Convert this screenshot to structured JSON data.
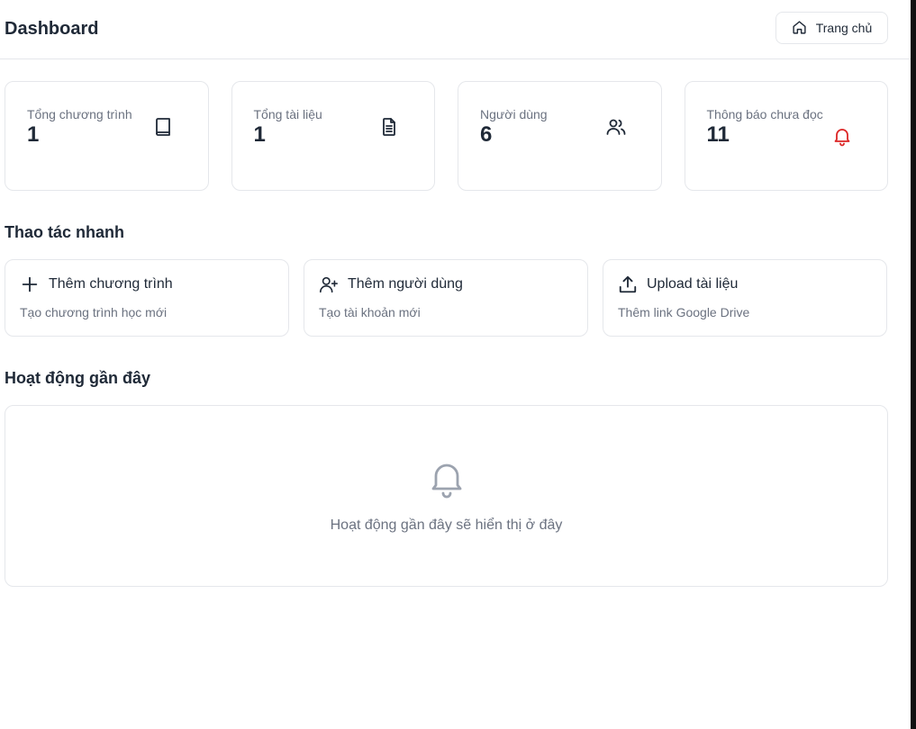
{
  "header": {
    "title": "Dashboard",
    "home_label": "Trang chủ"
  },
  "stats": [
    {
      "label": "Tổng chương trình",
      "value": "1",
      "icon": "book-icon"
    },
    {
      "label": "Tổng tài liệu",
      "value": "1",
      "icon": "document-icon"
    },
    {
      "label": "Người dùng",
      "value": "6",
      "icon": "users-icon"
    },
    {
      "label": "Thông báo chưa đọc",
      "value": "11",
      "icon": "bell-icon"
    }
  ],
  "quick_actions": {
    "title": "Thao tác nhanh",
    "items": [
      {
        "title": "Thêm chương trình",
        "description": "Tạo chương trình học mới",
        "icon": "plus-icon"
      },
      {
        "title": "Thêm người dùng",
        "description": "Tạo tài khoản mới",
        "icon": "user-plus-icon"
      },
      {
        "title": "Upload tài liệu",
        "description": "Thêm link Google Drive",
        "icon": "upload-icon"
      }
    ]
  },
  "recent": {
    "title": "Hoạt động gần đây",
    "empty_text": "Hoạt động gần đây sẽ hiển thị ở đây",
    "icon": "bell-icon"
  },
  "colors": {
    "text": "#1f2937",
    "muted": "#6b7280",
    "border": "#e5e7eb",
    "alert": "#dc2626",
    "empty_icon": "#9ca3af"
  }
}
